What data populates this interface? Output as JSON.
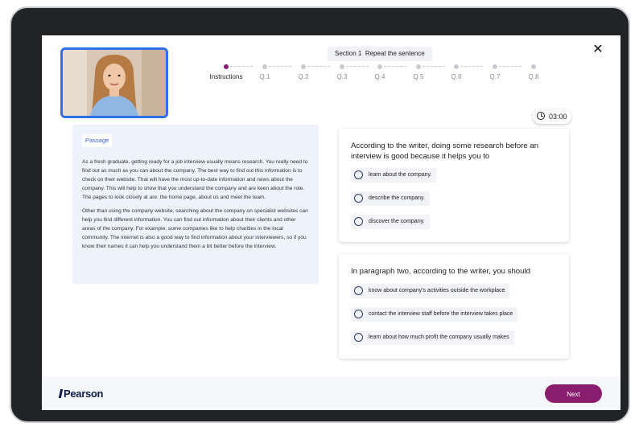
{
  "header": {
    "section_label": "Section 1",
    "section_name": "Repeat the sentence",
    "close_icon": "close-icon",
    "timer": "03:00"
  },
  "progress": {
    "steps": [
      "Instructions",
      "Q.1",
      "Q.2",
      "Q.3",
      "Q.4",
      "Q.5",
      "Q.6",
      "Q.7",
      "Q.8"
    ],
    "current_index": 0,
    "colors": {
      "active": "#8a1d6e",
      "inactive": "#c9cbd1"
    }
  },
  "passage": {
    "tag": "Passage",
    "paragraph1": "As a fresh graduate, getting ready for a job interview usually means research. You really need to find out as much as you can about the company. The best way to find out this information is to check on their website. That will have the most up-to-date information and news about the company. This will help to show that you understand the company and are keen about the role. The pages to look closely at are: the home page, about us and meet the team.",
    "paragraph2": "Other than using the company website, searching about the company on specialist websites can help you find different information. You can find out information about their clients and other areas of the company. For example, some companies like to help charities in the local community. The internet is also a good way to find information about your interviewers, so if you know their names it can help you understand them a bit better before the interview."
  },
  "questions": [
    {
      "text": "According to the writer, doing some research before an interview is good because it helps you to",
      "options": [
        "learn about the company.",
        "describe the company.",
        "discover the company."
      ]
    },
    {
      "text": "In paragraph two, according to the writer, you should",
      "options": [
        "know about company's activities outside the workplace",
        "contact the interview staff before the interview takes place",
        "learn about how much profit the company usually makes"
      ]
    }
  ],
  "footer": {
    "logo": "Pearson",
    "next_label": "Next",
    "brand_color": "#8a1d6e"
  }
}
